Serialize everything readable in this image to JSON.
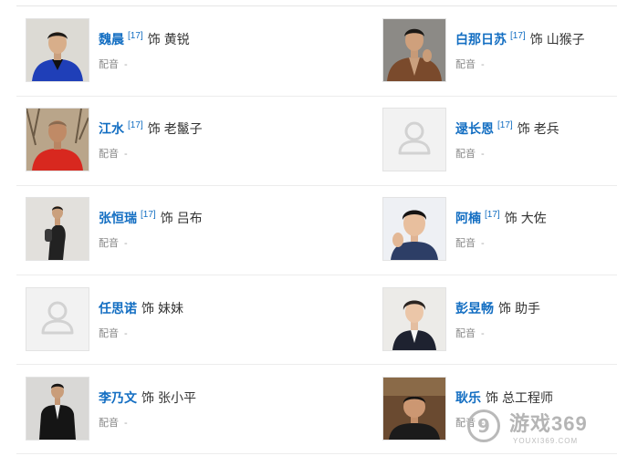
{
  "cast": [
    {
      "actor": "魏晨",
      "ref": "[17]",
      "as": "饰",
      "role": "黄锐",
      "voice_label": "配音",
      "voice": "-"
    },
    {
      "actor": "白那日苏",
      "ref": "[17]",
      "as": "饰",
      "role": "山猴子",
      "voice_label": "配音",
      "voice": "-"
    },
    {
      "actor": "江水",
      "ref": "[17]",
      "as": "饰",
      "role": "老鬣子",
      "voice_label": "配音",
      "voice": "-"
    },
    {
      "actor": "逯长恩",
      "ref": "[17]",
      "as": "饰",
      "role": "老兵",
      "voice_label": "配音",
      "voice": "-"
    },
    {
      "actor": "张恒瑞",
      "ref": "[17]",
      "as": "饰",
      "role": "吕布",
      "voice_label": "配音",
      "voice": "-"
    },
    {
      "actor": "阿楠",
      "ref": "[17]",
      "as": "饰",
      "role": "大佐",
      "voice_label": "配音",
      "voice": "-"
    },
    {
      "actor": "任思诺",
      "ref": "",
      "as": "饰",
      "role": "妹妹",
      "voice_label": "配音",
      "voice": "-"
    },
    {
      "actor": "彭昱畅",
      "ref": "",
      "as": "饰",
      "role": "助手",
      "voice_label": "配音",
      "voice": "-"
    },
    {
      "actor": "李乃文",
      "ref": "",
      "as": "饰",
      "role": "张小平",
      "voice_label": "配音",
      "voice": "-"
    },
    {
      "actor": "耿乐",
      "ref": "",
      "as": "饰",
      "role": "总工程师",
      "voice_label": "配音",
      "voice": "-"
    }
  ],
  "watermark": {
    "logo": "9",
    "title": "游戏369",
    "subtitle": "YOUXI369.COM"
  },
  "colors": {
    "link": "#136ec2",
    "text": "#333333",
    "muted": "#888888",
    "divider": "#ececec"
  }
}
